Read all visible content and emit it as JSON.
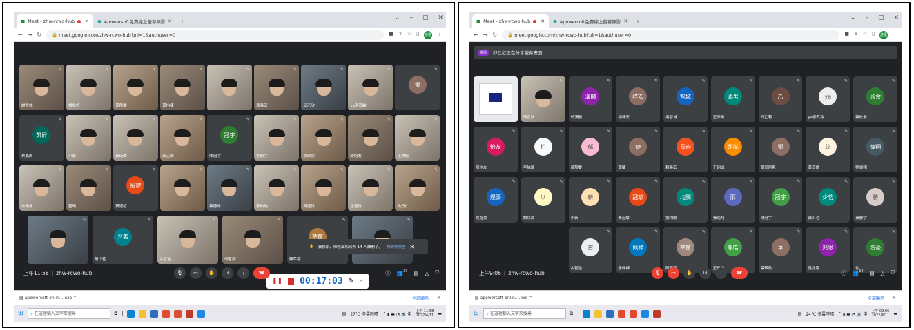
{
  "left": {
    "tabs": [
      {
        "label": "Meet - zhw-rcwo-hub"
      },
      {
        "label": "Apowersoft免費線上螢幕錄影"
      }
    ],
    "url": "meet.google.com/zhw-rcwo-hub?pli=1&authuser=0",
    "avatar_initials": "游惠",
    "tiles": [
      {
        "name": "謝智城",
        "type": "cam"
      },
      {
        "name": "楊咏悠",
        "type": "cam2"
      },
      {
        "name": "黃郁雯",
        "type": "cam4"
      },
      {
        "name": "黃怡婕",
        "type": "cam"
      },
      {
        "name": "",
        "type": "cam2"
      },
      {
        "name": "賴長宏",
        "type": "cam"
      },
      {
        "name": "邱乙欣",
        "type": "cam3"
      },
      {
        "name": "ya李其霖",
        "type": "cam2"
      },
      {
        "name": "",
        "type": "avatar",
        "initial": "鄧",
        "color": "#8d6e63"
      },
      {
        "name": "蔡凱屏",
        "type": "avatar",
        "initial": "凱屏",
        "color": "#00695c"
      },
      {
        "name": "小新",
        "type": "cam2"
      },
      {
        "name": "黃筠喬",
        "type": "cam2"
      },
      {
        "name": "邱乙晞",
        "type": "cam4"
      },
      {
        "name": "陳冠宇",
        "type": "avatar",
        "initial": "冠宇",
        "color": "#2e7d32"
      },
      {
        "name": "劉莉宇",
        "type": "cam2"
      },
      {
        "name": "蔡欣余",
        "type": "cam4"
      },
      {
        "name": "陳怡友",
        "type": "cam"
      },
      {
        "name": "王琪瑞",
        "type": "cam2"
      },
      {
        "name": "余佩倫",
        "type": "cam2"
      },
      {
        "name": "董晴",
        "type": "cam"
      },
      {
        "name": "黃冠諺",
        "type": "avatar",
        "initial": "冠諺",
        "color": "#e64a19"
      },
      {
        "name": "",
        "type": "cam4"
      },
      {
        "name": "蔡德維",
        "type": "cam3"
      },
      {
        "name": "李柏瑜",
        "type": "cam2"
      },
      {
        "name": "吳佳鈴",
        "type": "cam4"
      },
      {
        "name": "王佳鈴",
        "type": "cam2"
      },
      {
        "name": "吳丹仁",
        "type": "cam4"
      },
      {
        "name": "",
        "type": "cam3"
      },
      {
        "name": "蕭少茗",
        "type": "avatar",
        "initial": "少茗",
        "color": "#00838f"
      },
      {
        "name": "古智浩",
        "type": "cam2"
      },
      {
        "name": "邱家翔",
        "type": "cam"
      },
      {
        "name": "陳芊芸",
        "type": "avatar",
        "initial": "芊茵",
        "color": "#ad7a3c"
      },
      {
        "name": "",
        "type": "cam3"
      }
    ],
    "time": "上午11:58",
    "meeting_code": "zhw-rcwo-hub",
    "participants_count": "33",
    "recorder_time": "00:17:03",
    "toast_text": "黃郁凱、陳怡友和另外 14 人離開了。",
    "toast_link": "開啟等候室",
    "download_file": "apowersoft-onlin....exe",
    "show_all": "全部顯示",
    "search_placeholder": "在這裡輸入文字來搜尋",
    "weather": "27°C 多雲時晴",
    "clock_time": "上午 11:58",
    "clock_date": "2022/4/11"
  },
  "right": {
    "tabs": [
      {
        "label": "Meet - zhw-rcwo-hub"
      },
      {
        "label": "Apowersoft免費線上螢幕錄影"
      }
    ],
    "url": "meet.google.com/zhw-rcwo-hub?pli=1&authuser=0",
    "avatar_initials": "游惠",
    "banner_badge": "游惠",
    "banner_text": "邱乙欣正在分享螢幕畫面",
    "tiles": [
      {
        "name": "",
        "type": "screen"
      },
      {
        "name": "邱乙欣",
        "type": "cam2"
      },
      {
        "name": "邱漢麟",
        "type": "avatar",
        "initial": "漢麟",
        "color": "#8e24aa"
      },
      {
        "name": "楊梓宏",
        "type": "avatar",
        "initial": "梓宏",
        "color": "#8d6e63"
      },
      {
        "name": "謝智城",
        "type": "avatar",
        "initial": "智城",
        "color": "#1565c0"
      },
      {
        "name": "王添男",
        "type": "avatar",
        "initial": "添男",
        "color": "#00897b"
      },
      {
        "name": "邱乙莉",
        "type": "avatar",
        "initial": "乙",
        "color": "#6d4c41"
      },
      {
        "name": "ya李其霖",
        "type": "avatar",
        "initial": "ya",
        "color": "#eeeeee"
      },
      {
        "name": "蔡欣余",
        "type": "avatar",
        "initial": "欣余",
        "color": "#2e7d32"
      },
      {
        "name": "陳怡友",
        "type": "avatar",
        "initial": "怡友",
        "color": "#d81b60"
      },
      {
        "name": "李柏瑜",
        "type": "avatar",
        "initial": "柏",
        "color": "#fafafa"
      },
      {
        "name": "黃郁雯",
        "type": "avatar",
        "initial": "郁",
        "color": "#f8bbd0"
      },
      {
        "name": "蕭婕",
        "type": "avatar",
        "initial": "婕",
        "color": "#8d6e63"
      },
      {
        "name": "賴長宏",
        "type": "avatar",
        "initial": "長宏",
        "color": "#f4511e"
      },
      {
        "name": "王胡誠",
        "type": "avatar",
        "initial": "胡誠",
        "color": "#fb8c00"
      },
      {
        "name": "鄧寧宗恩",
        "type": "avatar",
        "initial": "鄧",
        "color": "#8d6e63"
      },
      {
        "name": "黃筠喬",
        "type": "avatar",
        "initial": "筠",
        "color": "#fff3e0"
      },
      {
        "name": "劉煒翔",
        "type": "avatar",
        "initial": "煒翔",
        "color": "#455a64"
      },
      {
        "name": "吳煜豪",
        "type": "avatar",
        "initial": "煜豪",
        "color": "#1565c0"
      },
      {
        "name": "謝以晨",
        "type": "avatar",
        "initial": "以",
        "color": "#fff9c4"
      },
      {
        "name": "小新",
        "type": "avatar",
        "initial": "新",
        "color": "#ffe0b2"
      },
      {
        "name": "黃冠諺",
        "type": "avatar",
        "initial": "冠諺",
        "color": "#e64a19"
      },
      {
        "name": "劉均閔",
        "type": "avatar",
        "initial": "均閔",
        "color": "#00897b"
      },
      {
        "name": "張雨翔",
        "type": "avatar",
        "initial": "雨",
        "color": "#5c6bc0"
      },
      {
        "name": "陳冠宇",
        "type": "avatar",
        "initial": "冠宇",
        "color": "#43a047"
      },
      {
        "name": "蕭少茗",
        "type": "avatar",
        "initial": "少茗",
        "color": "#00897b"
      },
      {
        "name": "黃勝宇",
        "type": "avatar",
        "initial": "勝",
        "color": "#d7ccc8"
      },
      {
        "name": "",
        "type": "empty"
      },
      {
        "name": "古智浩",
        "type": "avatar",
        "initial": "古",
        "color": "#eceff1"
      },
      {
        "name": "余佩樺",
        "type": "avatar",
        "initial": "佩樺",
        "color": "#0277bd"
      },
      {
        "name": "陳芊茵",
        "type": "avatar",
        "initial": "芊茵",
        "color": "#a1887f"
      },
      {
        "name": "王胤皓",
        "type": "avatar",
        "initial": "胤皓",
        "color": "#43a047"
      },
      {
        "name": "葉華鈴",
        "type": "avatar",
        "initial": "華",
        "color": "#8d6e63"
      },
      {
        "name": "吳兆恩",
        "type": "avatar",
        "initial": "兆恩",
        "color": "#8e24aa"
      },
      {
        "name": "你",
        "type": "avatar",
        "initial": "煜豪",
        "color": "#2e7d32"
      }
    ],
    "time": "上午9:06",
    "meeting_code": "zhw-rcwo-hub",
    "participants_count": "34",
    "download_file": "apowersoft-onlin....exe",
    "show_all": "全部顯示",
    "search_placeholder": "在這裡輸入文字來搜尋",
    "weather": "24°C 多雲時晴",
    "clock_time": "上午 09:06",
    "clock_date": "2022/4/11"
  }
}
